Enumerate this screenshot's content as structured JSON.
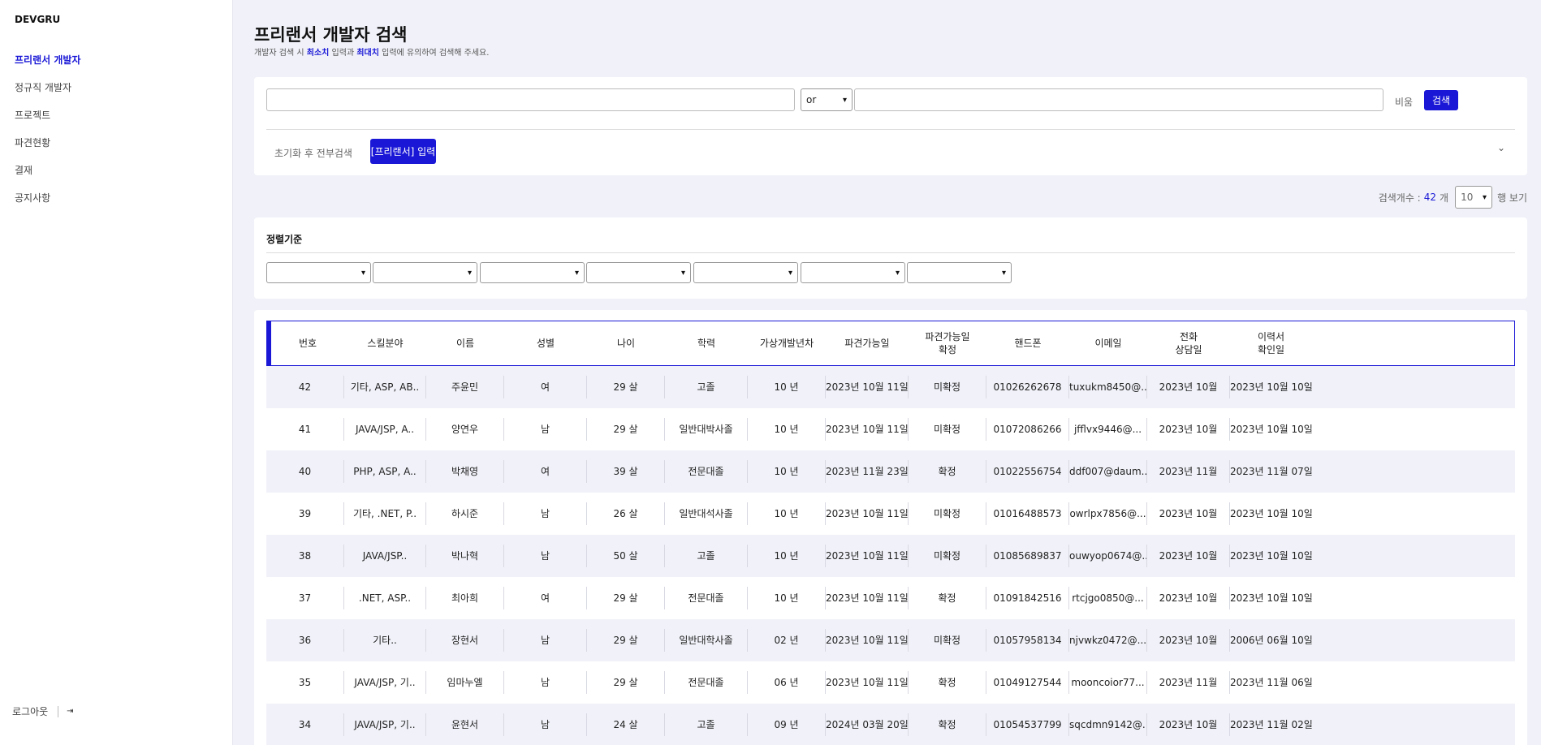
{
  "app": {
    "name": "DEVGRU"
  },
  "sidebar": {
    "items": [
      {
        "label": "프리랜서 개발자",
        "active": true
      },
      {
        "label": "정규직 개발자",
        "active": false
      },
      {
        "label": "프로젝트",
        "active": false
      },
      {
        "label": "파견현황",
        "active": false
      },
      {
        "label": "결재",
        "active": false
      },
      {
        "label": "공지사항",
        "active": false
      }
    ],
    "logout_label": "로그아웃",
    "logout_icon": "logout-icon"
  },
  "page": {
    "title": "프리랜서 개발자 검색",
    "subtitle_parts": [
      "개발자 검색 시 ",
      "최소치",
      " 입력과 ",
      "최대치",
      " 입력에 유의하여 검색해 주세요."
    ]
  },
  "search": {
    "left_value": "",
    "operator": "or",
    "right_value": "",
    "not_label": "비움",
    "search_button": "검색",
    "reset_label": "초기화 후 전부검색",
    "input_button": "[프리랜서] 입력"
  },
  "results": {
    "count_label": "검색개수 :",
    "count": "42",
    "count_unit": "개",
    "rows_per_page": "10",
    "rows_label": "행 보기"
  },
  "sort": {
    "title": "정렬기준",
    "selects": [
      "",
      "",
      "",
      "",
      "",
      "",
      ""
    ]
  },
  "table": {
    "headers": [
      "번호",
      "스킬분야",
      "이름",
      "성별",
      "나이",
      "학력",
      "가상개발년차",
      "파견가능일",
      "파견가능일\n확정",
      "핸드폰",
      "이메일",
      "전화\n상담일",
      "이력서\n확인일"
    ],
    "rows": [
      [
        "42",
        "기타, ASP, AB..",
        "주윤민",
        "여",
        "29 살",
        "고졸",
        "10 년",
        "2023년 10월 11일",
        "미확정",
        "01026262678",
        "tuxukm8450@...",
        "2023년 10월",
        "2023년 10월 10일"
      ],
      [
        "41",
        "JAVA/JSP, A..",
        "양연우",
        "남",
        "29 살",
        "일반대박사졸",
        "10 년",
        "2023년 10월 11일",
        "미확정",
        "01072086266",
        "jfflvx9446@...",
        "2023년 10월",
        "2023년 10월 10일"
      ],
      [
        "40",
        "PHP, ASP, A..",
        "박채영",
        "여",
        "39 살",
        "전문대졸",
        "10 년",
        "2023년 11월 23일",
        "확정",
        "01022556754",
        "ddf007@daum...",
        "2023년 11월",
        "2023년 11월 07일"
      ],
      [
        "39",
        "기타, .NET, P..",
        "하시준",
        "남",
        "26 살",
        "일반대석사졸",
        "10 년",
        "2023년 10월 11일",
        "미확정",
        "01016488573",
        "owrlpx7856@...",
        "2023년 10월",
        "2023년 10월 10일"
      ],
      [
        "38",
        "JAVA/JSP..",
        "박나혁",
        "남",
        "50 살",
        "고졸",
        "10 년",
        "2023년 10월 11일",
        "미확정",
        "01085689837",
        "ouwyop0674@...",
        "2023년 10월",
        "2023년 10월 10일"
      ],
      [
        "37",
        ".NET, ASP..",
        "최아희",
        "여",
        "29 살",
        "전문대졸",
        "10 년",
        "2023년 10월 11일",
        "확정",
        "01091842516",
        "rtcjgo0850@...",
        "2023년 10월",
        "2023년 10월 10일"
      ],
      [
        "36",
        "기타..",
        "장현서",
        "남",
        "29 살",
        "일반대학사졸",
        "02 년",
        "2023년 10월 11일",
        "미확정",
        "01057958134",
        "njvwkz0472@...",
        "2023년 10월",
        "2006년 06월 10일"
      ],
      [
        "35",
        "JAVA/JSP, 기..",
        "임마누엘",
        "남",
        "29 살",
        "전문대졸",
        "06 년",
        "2023년 10월 11일",
        "확정",
        "01049127544",
        "mooncoior77...",
        "2023년 11월",
        "2023년 11월 06일"
      ],
      [
        "34",
        "JAVA/JSP, 기..",
        "윤현서",
        "남",
        "24 살",
        "고졸",
        "09 년",
        "2024년 03월 20일",
        "확정",
        "01054537799",
        "sqcdmn9142@...",
        "2023년 10월",
        "2023년 11월 02일"
      ]
    ]
  }
}
